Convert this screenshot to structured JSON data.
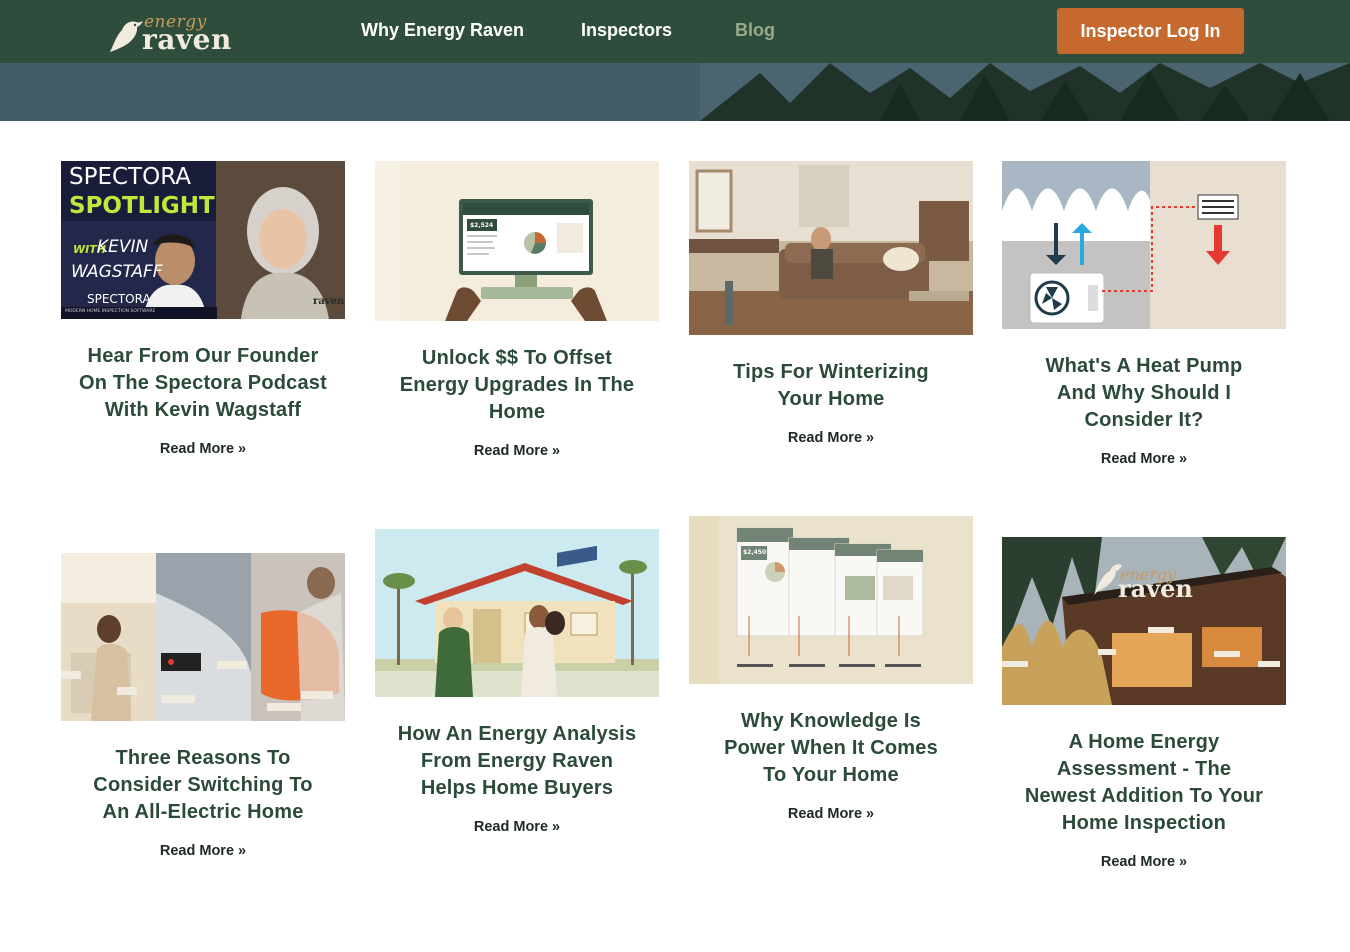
{
  "brand": {
    "logo_small": "energy",
    "logo_main": "raven"
  },
  "nav": {
    "items": [
      {
        "label": "Why Energy Raven"
      },
      {
        "label": "Inspectors"
      },
      {
        "label": "Blog"
      }
    ],
    "login_label": "Inspector Log In"
  },
  "posts": [
    {
      "title": "Hear From Our Founder On The Spectora Podcast With Kevin Wagstaff",
      "read_more": "Read More »"
    },
    {
      "title": "Unlock $$ To Offset Energy Upgrades In The Home",
      "read_more": "Read More »"
    },
    {
      "title": "Tips For Winterizing Your Home",
      "read_more": "Read More »"
    },
    {
      "title": "What's A Heat Pump And Why Should I Consider It?",
      "read_more": "Read More »"
    },
    {
      "title": "Three Reasons To Consider Switching To An All-Electric Home",
      "read_more": "Read More »"
    },
    {
      "title": "How An Energy Analysis From Energy Raven Helps Home Buyers",
      "read_more": "Read More »"
    },
    {
      "title": "Why Knowledge Is Power When It Comes To Your Home",
      "read_more": "Read More »"
    },
    {
      "title": "A Home Energy Assessment - The Newest Addition To Your Home Inspection",
      "read_more": "Read More »"
    }
  ],
  "thumb_text": {
    "spectora_line1": "SPECTORA",
    "spectora_line2": "SPOTLIGHT",
    "spectora_with": "WITH",
    "spectora_name1": "KEVIN",
    "spectora_name2": "WAGSTAFF",
    "spectora_brand": "SPECTORA",
    "spectora_tagline": "MODERN HOME INSPECTION SOFTWARE",
    "spectora_corner": "raven",
    "dashboard_amount": "$2,524",
    "report_amount": "$2,450",
    "house_logo_small": "energy",
    "house_logo_main": "raven"
  },
  "colors": {
    "header_bg": "#2f4d3d",
    "accent": "#c5692f",
    "title_green": "#2c4a3a",
    "nav_active": "#9aa98b"
  }
}
